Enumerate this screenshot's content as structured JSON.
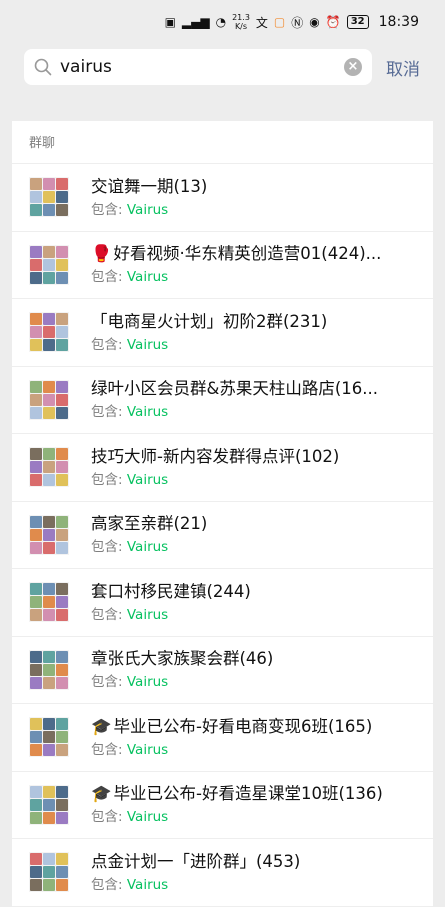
{
  "status": {
    "net_speed_top": "21.3",
    "net_speed_bottom": "K/s",
    "battery": "32",
    "time": "18:39"
  },
  "search": {
    "query": "vairus",
    "cancel_label": "取消"
  },
  "section_label": "群聊",
  "sub_prefix": "包含:",
  "groups": [
    {
      "title": "交谊舞一期(13)",
      "match": "Vairus",
      "prefix": ""
    },
    {
      "title": "好看视频·华东精英创造营01(424)...",
      "match": "Vairus",
      "prefix": "🥊"
    },
    {
      "title": "「电商星火计划」初阶2群(231)",
      "match": "Vairus",
      "prefix": ""
    },
    {
      "title": "绿叶小区会员群&苏果天柱山路店(16...",
      "match": "Vairus",
      "prefix": ""
    },
    {
      "title": "技巧大师-新内容发群得点评(102)",
      "match": "Vairus",
      "prefix": ""
    },
    {
      "title": "高家至亲群(21)",
      "match": "Vairus",
      "prefix": ""
    },
    {
      "title": "套口村移民建镇(244)",
      "match": "Vairus",
      "prefix": ""
    },
    {
      "title": "章张氏大家族聚会群(46)",
      "match": "Vairus",
      "prefix": ""
    },
    {
      "title": "毕业已公布-好看电商变现6班(165)",
      "match": "Vairus",
      "prefix": "🎓"
    },
    {
      "title": "毕业已公布-好看造星课堂10班(136)",
      "match": "Vairus",
      "prefix": "🎓"
    },
    {
      "title": "点金计划一「进阶群」(453)",
      "match": "Vairus",
      "prefix": ""
    }
  ]
}
